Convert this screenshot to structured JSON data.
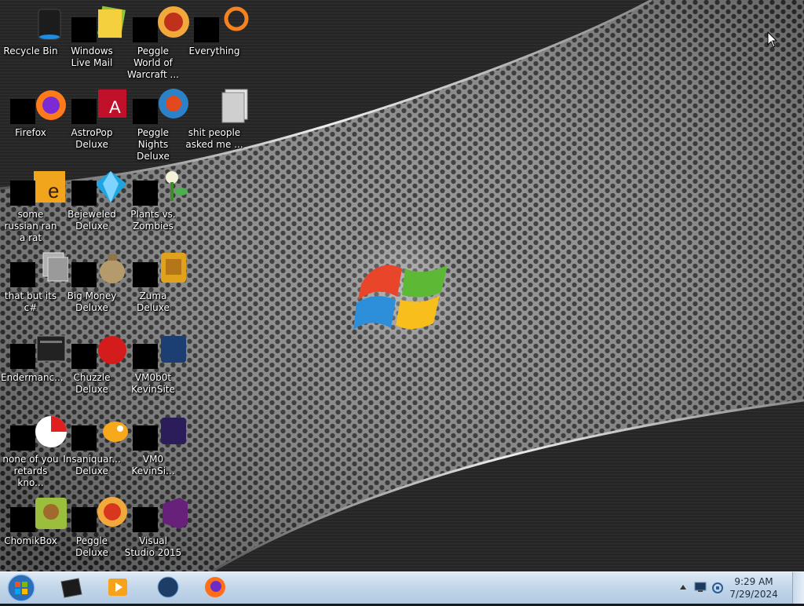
{
  "desktop": {
    "icons": [
      {
        "id": "recycle-bin",
        "label": "Recycle Bin"
      },
      {
        "id": "firefox",
        "label": "Firefox"
      },
      {
        "id": "some-russian",
        "label": "some russian ran a rat"
      },
      {
        "id": "that-but",
        "label": "that but its c#"
      },
      {
        "id": "endermanch",
        "label": "Endermanc..."
      },
      {
        "id": "none-of-you",
        "label": "none of you retards kno..."
      },
      {
        "id": "chomikbox",
        "label": "ChomikBox"
      },
      {
        "id": "windows-live-mail",
        "label": "Windows Live Mail"
      },
      {
        "id": "astropop",
        "label": "AstroPop Deluxe"
      },
      {
        "id": "bejeweled",
        "label": "Bejeweled Deluxe"
      },
      {
        "id": "big-money",
        "label": "Big Money Deluxe"
      },
      {
        "id": "chuzzle",
        "label": "Chuzzle Deluxe"
      },
      {
        "id": "insaniquarium",
        "label": "Insaniquar... Deluxe"
      },
      {
        "id": "peggle-deluxe",
        "label": "Peggle Deluxe"
      },
      {
        "id": "peggle-wow",
        "label": "Peggle World of Warcraft ..."
      },
      {
        "id": "peggle-nights",
        "label": "Peggle Nights Deluxe"
      },
      {
        "id": "pvz",
        "label": "Plants vs. Zombies"
      },
      {
        "id": "zuma",
        "label": "Zuma Deluxe"
      },
      {
        "id": "vm0b0t",
        "label": "VM0b0t KevinSite"
      },
      {
        "id": "vm0",
        "label": "VM0 KevinSi..."
      },
      {
        "id": "visual-studio",
        "label": "Visual Studio 2015"
      },
      {
        "id": "everything",
        "label": "Everything"
      },
      {
        "id": "shit-people",
        "label": "shit people asked me ..."
      }
    ]
  },
  "taskbar": {
    "pinned": [
      {
        "id": "explorer",
        "icon": "folder-icon"
      },
      {
        "id": "media-player",
        "icon": "media-player-icon"
      },
      {
        "id": "globe",
        "icon": "globe-icon"
      },
      {
        "id": "firefox",
        "icon": "firefox-icon"
      }
    ],
    "clock": {
      "time": "9:29 AM",
      "date": "7/29/2024"
    }
  },
  "colors": {
    "taskbar": "#c4d7ea",
    "desktop_text": "#ffffff",
    "censor": "#000000"
  }
}
